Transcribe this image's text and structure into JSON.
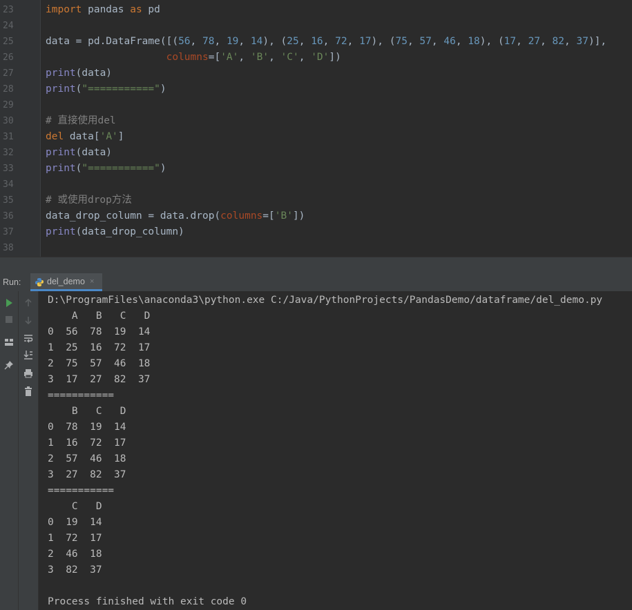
{
  "editor": {
    "line_numbers": [
      "23",
      "24",
      "25",
      "26",
      "27",
      "28",
      "29",
      "30",
      "31",
      "32",
      "33",
      "34",
      "35",
      "36",
      "37",
      "38"
    ],
    "lines": [
      [
        {
          "t": "import",
          "c": "kw"
        },
        {
          "t": " pandas ",
          "c": "pl"
        },
        {
          "t": "as",
          "c": "kw"
        },
        {
          "t": " pd",
          "c": "pl"
        }
      ],
      [],
      [
        {
          "t": "data = pd.DataFrame([(",
          "c": "pl"
        },
        {
          "t": "56",
          "c": "num"
        },
        {
          "t": ", ",
          "c": "pl"
        },
        {
          "t": "78",
          "c": "num"
        },
        {
          "t": ", ",
          "c": "pl"
        },
        {
          "t": "19",
          "c": "num"
        },
        {
          "t": ", ",
          "c": "pl"
        },
        {
          "t": "14",
          "c": "num"
        },
        {
          "t": "), (",
          "c": "pl"
        },
        {
          "t": "25",
          "c": "num"
        },
        {
          "t": ", ",
          "c": "pl"
        },
        {
          "t": "16",
          "c": "num"
        },
        {
          "t": ", ",
          "c": "pl"
        },
        {
          "t": "72",
          "c": "num"
        },
        {
          "t": ", ",
          "c": "pl"
        },
        {
          "t": "17",
          "c": "num"
        },
        {
          "t": "), (",
          "c": "pl"
        },
        {
          "t": "75",
          "c": "num"
        },
        {
          "t": ", ",
          "c": "pl"
        },
        {
          "t": "57",
          "c": "num"
        },
        {
          "t": ", ",
          "c": "pl"
        },
        {
          "t": "46",
          "c": "num"
        },
        {
          "t": ", ",
          "c": "pl"
        },
        {
          "t": "18",
          "c": "num"
        },
        {
          "t": "), (",
          "c": "pl"
        },
        {
          "t": "17",
          "c": "num"
        },
        {
          "t": ", ",
          "c": "pl"
        },
        {
          "t": "27",
          "c": "num"
        },
        {
          "t": ", ",
          "c": "pl"
        },
        {
          "t": "82",
          "c": "num"
        },
        {
          "t": ", ",
          "c": "pl"
        },
        {
          "t": "37",
          "c": "num"
        },
        {
          "t": ")],",
          "c": "pl"
        }
      ],
      [
        {
          "t": "                    ",
          "c": "pl"
        },
        {
          "t": "columns",
          "c": "pm"
        },
        {
          "t": "=[",
          "c": "pl"
        },
        {
          "t": "'A'",
          "c": "str"
        },
        {
          "t": ", ",
          "c": "pl"
        },
        {
          "t": "'B'",
          "c": "str"
        },
        {
          "t": ", ",
          "c": "pl"
        },
        {
          "t": "'C'",
          "c": "str"
        },
        {
          "t": ", ",
          "c": "pl"
        },
        {
          "t": "'D'",
          "c": "str"
        },
        {
          "t": "])",
          "c": "pl"
        }
      ],
      [
        {
          "t": "print",
          "c": "fn"
        },
        {
          "t": "(data)",
          "c": "pl"
        }
      ],
      [
        {
          "t": "print",
          "c": "fn"
        },
        {
          "t": "(",
          "c": "pl"
        },
        {
          "t": "\"===========\"",
          "c": "str"
        },
        {
          "t": ")",
          "c": "pl"
        }
      ],
      [],
      [
        {
          "t": "# 直接使用del",
          "c": "cm"
        }
      ],
      [
        {
          "t": "del",
          "c": "kw"
        },
        {
          "t": " data[",
          "c": "pl"
        },
        {
          "t": "'A'",
          "c": "str"
        },
        {
          "t": "]",
          "c": "pl"
        }
      ],
      [
        {
          "t": "print",
          "c": "fn"
        },
        {
          "t": "(data)",
          "c": "pl"
        }
      ],
      [
        {
          "t": "print",
          "c": "fn"
        },
        {
          "t": "(",
          "c": "pl"
        },
        {
          "t": "\"===========\"",
          "c": "str"
        },
        {
          "t": ")",
          "c": "pl"
        }
      ],
      [],
      [
        {
          "t": "# 或使用drop方法",
          "c": "cm"
        }
      ],
      [
        {
          "t": "data_drop_column = data.drop(",
          "c": "pl"
        },
        {
          "t": "columns",
          "c": "pm"
        },
        {
          "t": "=[",
          "c": "pl"
        },
        {
          "t": "'B'",
          "c": "str"
        },
        {
          "t": "])",
          "c": "pl"
        }
      ],
      [
        {
          "t": "print",
          "c": "fn"
        },
        {
          "t": "(data_drop_column)",
          "c": "pl"
        }
      ],
      []
    ]
  },
  "run": {
    "label": "Run:",
    "tab_name": "del_demo",
    "tab_close": "×"
  },
  "toolbar_icons": [
    "run-icon",
    "stop-icon",
    "layout-icon",
    "pin-icon"
  ],
  "toolbar2_icons": [
    "up-arrow-icon",
    "down-arrow-icon",
    "soft-wrap-icon",
    "scroll-to-end-icon",
    "print-icon",
    "trash-icon"
  ],
  "console": {
    "lines": [
      "D:\\ProgramFiles\\anaconda3\\python.exe C:/Java/PythonProjects/PandasDemo/dataframe/del_demo.py",
      "    A   B   C   D",
      "0  56  78  19  14",
      "1  25  16  72  17",
      "2  75  57  46  18",
      "3  17  27  82  37",
      "===========",
      "    B   C   D",
      "0  78  19  14",
      "1  16  72  17",
      "2  57  46  18",
      "3  27  82  37",
      "===========",
      "    C   D",
      "0  19  14",
      "1  72  17",
      "2  46  18",
      "3  82  37",
      "",
      "Process finished with exit code 0"
    ]
  },
  "colors": {
    "editor_bg": "#2b2b2b",
    "keyword": "#cc7832",
    "number": "#6897bb",
    "string": "#6a8759",
    "builtin": "#8888c6",
    "comment": "#808080",
    "run_green": "#499c54"
  }
}
